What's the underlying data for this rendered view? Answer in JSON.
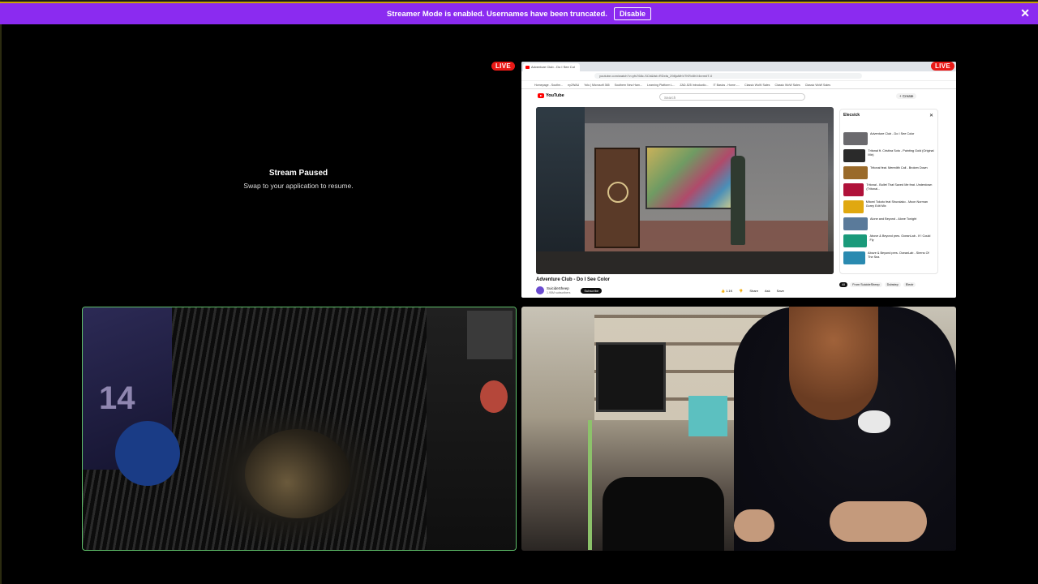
{
  "banner": {
    "message": "Streamer Mode is enabled. Usernames have been truncated.",
    "disable_label": "Disable",
    "close_symbol": "✕",
    "background_color": "#8b2bf0"
  },
  "paused_tile": {
    "live_label": "LIVE",
    "title": "Stream Paused",
    "subtitle": "Swap to your application to resume."
  },
  "share_tile": {
    "live_label": "LIVE",
    "browser_tab": "Adventure Club - Do I See Col",
    "url": "youtube.com/watch?v=yfs768c-SCb&list=RDxfa_298juMhV7KRx5hV4nrm#T-0",
    "bookmarks": [
      "Homepage - Southe...",
      "ey2WAU",
      "Yolu | Microsoft 365",
      "Southern New Ham...",
      "Learning Platform L...",
      "ZAD-525 Introductio...",
      "IT Basics - Home -...",
      "Classic WoW Sales",
      "Classic WoW Sales",
      "Classic WoW Sales"
    ],
    "yt_logo": "YouTube",
    "search_placeholder": "Search",
    "create_label": "+ Create",
    "video_title": "Adventure Club - Do I See Color",
    "channel": "SuicideSheep",
    "subscribers": "1.95M subscribers",
    "subscribe_label": "Subscribe",
    "actions": [
      "👍 1.1K",
      "👎",
      "Share",
      "Ask",
      "Save"
    ],
    "playlist_title": "Elecsick",
    "playlist_items": [
      "Adventure Club - Do I See Color",
      "Tritonal ft. Cristina Soto - Painting Gold (Original Mix)",
      "Tritonal feat. Meredith Call - Broken Down",
      "Tritonal - Bullet That Saved Me feat. Underdown (Tritonal...",
      "Mitomi Tokoto feat Shuraiako - Moon Norman Gorey Edit Mix",
      "Alone and Beyond - Alone Tonight",
      "Above & Beyond pres. OceanLab - If I Could Fly",
      "Above & Beyond pres. OceanLab - Sirens Of The Sea"
    ],
    "chips": [
      "All",
      "From SuicideSheep",
      "Dubstep",
      "Electr"
    ]
  },
  "cams": {
    "left_border_color": "#5fc06a",
    "left_jersey_number": "14"
  }
}
